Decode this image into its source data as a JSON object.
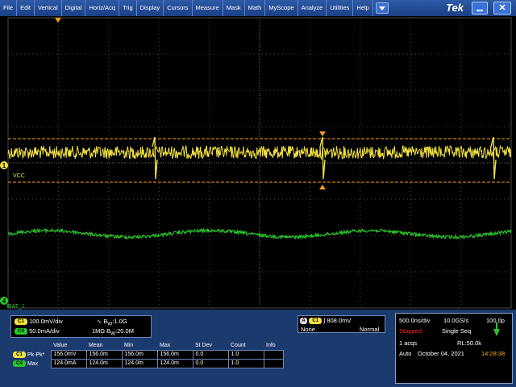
{
  "menu": {
    "items": [
      "File",
      "Edit",
      "Vertical",
      "Digital",
      "Horiz/Acq",
      "Trig",
      "Display",
      "Cursors",
      "Measure",
      "Mask",
      "Math",
      "MyScope",
      "Analyze",
      "Utilities",
      "Help"
    ],
    "brand": "Tek"
  },
  "graticule": {
    "ch1_marker": "1",
    "ch1_label": "VCC",
    "ch4_marker": "4",
    "ch4_label": "IBAT_1"
  },
  "channels": {
    "ch1": {
      "badge": "C1",
      "scale": "100.0mV/div",
      "bw": "B",
      "bw_sub": "W",
      "bw_value": ":1.0G"
    },
    "ch4": {
      "badge": "C4",
      "scale": "50.0mA/div",
      "impedance": "1MΩ",
      "bw": "B",
      "bw_sub": "W",
      "bw_value": ":20.0M"
    }
  },
  "trigger": {
    "badge_a": "A",
    "badge_ch": "C1",
    "level": "808.0mV",
    "coupling": "None",
    "mode": "Normal"
  },
  "measurements": {
    "headers": [
      "Value",
      "Mean",
      "Min",
      "Max",
      "St Dev",
      "Count",
      "Info"
    ],
    "rows": [
      {
        "badge": "C1",
        "name": "Pk-Pk*",
        "values": [
          "156.0mV",
          "156.0m",
          "156.0m",
          "156.0m",
          "0.0",
          "1.0",
          ""
        ]
      },
      {
        "badge": "C4",
        "name": "Max",
        "values": [
          "124.0mA",
          "124.0m",
          "124.0m",
          "124.0m",
          "0.0",
          "1.0",
          ""
        ]
      }
    ]
  },
  "acquisition": {
    "timebase": "500.0ns/div",
    "sample_rate": "10.0GS/s",
    "resolution": "100.0p",
    "state": "Stopped",
    "mode": "Single Seq",
    "acqs": "1 acqs",
    "record_length": "RL:50.0k",
    "trigger_mode": "Auto",
    "date": "October 04, 2021",
    "time": "14:28:38"
  },
  "colors": {
    "ch1": "#f0e040",
    "ch4": "#28c828",
    "trigger": "#ff9a1a",
    "grid": "#4a4a4a",
    "background": "#000000"
  }
}
